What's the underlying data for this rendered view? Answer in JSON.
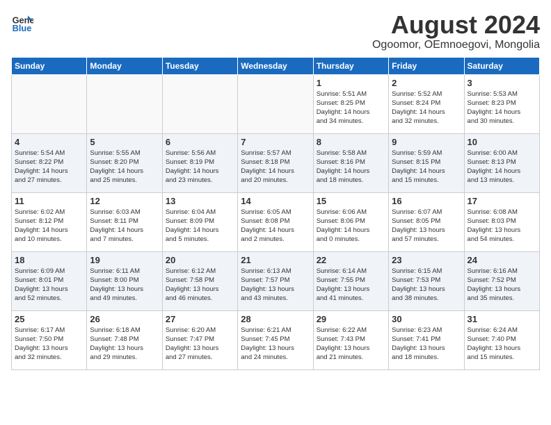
{
  "logo": {
    "general": "General",
    "blue": "Blue"
  },
  "title": "August 2024",
  "subtitle": "Ogoomor, OEmnoegovi, Mongolia",
  "days_of_week": [
    "Sunday",
    "Monday",
    "Tuesday",
    "Wednesday",
    "Thursday",
    "Friday",
    "Saturday"
  ],
  "weeks": [
    [
      {
        "day": "",
        "info": ""
      },
      {
        "day": "",
        "info": ""
      },
      {
        "day": "",
        "info": ""
      },
      {
        "day": "",
        "info": ""
      },
      {
        "day": "1",
        "info": "Sunrise: 5:51 AM\nSunset: 8:25 PM\nDaylight: 14 hours\nand 34 minutes."
      },
      {
        "day": "2",
        "info": "Sunrise: 5:52 AM\nSunset: 8:24 PM\nDaylight: 14 hours\nand 32 minutes."
      },
      {
        "day": "3",
        "info": "Sunrise: 5:53 AM\nSunset: 8:23 PM\nDaylight: 14 hours\nand 30 minutes."
      }
    ],
    [
      {
        "day": "4",
        "info": "Sunrise: 5:54 AM\nSunset: 8:22 PM\nDaylight: 14 hours\nand 27 minutes."
      },
      {
        "day": "5",
        "info": "Sunrise: 5:55 AM\nSunset: 8:20 PM\nDaylight: 14 hours\nand 25 minutes."
      },
      {
        "day": "6",
        "info": "Sunrise: 5:56 AM\nSunset: 8:19 PM\nDaylight: 14 hours\nand 23 minutes."
      },
      {
        "day": "7",
        "info": "Sunrise: 5:57 AM\nSunset: 8:18 PM\nDaylight: 14 hours\nand 20 minutes."
      },
      {
        "day": "8",
        "info": "Sunrise: 5:58 AM\nSunset: 8:16 PM\nDaylight: 14 hours\nand 18 minutes."
      },
      {
        "day": "9",
        "info": "Sunrise: 5:59 AM\nSunset: 8:15 PM\nDaylight: 14 hours\nand 15 minutes."
      },
      {
        "day": "10",
        "info": "Sunrise: 6:00 AM\nSunset: 8:13 PM\nDaylight: 14 hours\nand 13 minutes."
      }
    ],
    [
      {
        "day": "11",
        "info": "Sunrise: 6:02 AM\nSunset: 8:12 PM\nDaylight: 14 hours\nand 10 minutes."
      },
      {
        "day": "12",
        "info": "Sunrise: 6:03 AM\nSunset: 8:11 PM\nDaylight: 14 hours\nand 7 minutes."
      },
      {
        "day": "13",
        "info": "Sunrise: 6:04 AM\nSunset: 8:09 PM\nDaylight: 14 hours\nand 5 minutes."
      },
      {
        "day": "14",
        "info": "Sunrise: 6:05 AM\nSunset: 8:08 PM\nDaylight: 14 hours\nand 2 minutes."
      },
      {
        "day": "15",
        "info": "Sunrise: 6:06 AM\nSunset: 8:06 PM\nDaylight: 14 hours\nand 0 minutes."
      },
      {
        "day": "16",
        "info": "Sunrise: 6:07 AM\nSunset: 8:05 PM\nDaylight: 13 hours\nand 57 minutes."
      },
      {
        "day": "17",
        "info": "Sunrise: 6:08 AM\nSunset: 8:03 PM\nDaylight: 13 hours\nand 54 minutes."
      }
    ],
    [
      {
        "day": "18",
        "info": "Sunrise: 6:09 AM\nSunset: 8:01 PM\nDaylight: 13 hours\nand 52 minutes."
      },
      {
        "day": "19",
        "info": "Sunrise: 6:11 AM\nSunset: 8:00 PM\nDaylight: 13 hours\nand 49 minutes."
      },
      {
        "day": "20",
        "info": "Sunrise: 6:12 AM\nSunset: 7:58 PM\nDaylight: 13 hours\nand 46 minutes."
      },
      {
        "day": "21",
        "info": "Sunrise: 6:13 AM\nSunset: 7:57 PM\nDaylight: 13 hours\nand 43 minutes."
      },
      {
        "day": "22",
        "info": "Sunrise: 6:14 AM\nSunset: 7:55 PM\nDaylight: 13 hours\nand 41 minutes."
      },
      {
        "day": "23",
        "info": "Sunrise: 6:15 AM\nSunset: 7:53 PM\nDaylight: 13 hours\nand 38 minutes."
      },
      {
        "day": "24",
        "info": "Sunrise: 6:16 AM\nSunset: 7:52 PM\nDaylight: 13 hours\nand 35 minutes."
      }
    ],
    [
      {
        "day": "25",
        "info": "Sunrise: 6:17 AM\nSunset: 7:50 PM\nDaylight: 13 hours\nand 32 minutes."
      },
      {
        "day": "26",
        "info": "Sunrise: 6:18 AM\nSunset: 7:48 PM\nDaylight: 13 hours\nand 29 minutes."
      },
      {
        "day": "27",
        "info": "Sunrise: 6:20 AM\nSunset: 7:47 PM\nDaylight: 13 hours\nand 27 minutes."
      },
      {
        "day": "28",
        "info": "Sunrise: 6:21 AM\nSunset: 7:45 PM\nDaylight: 13 hours\nand 24 minutes."
      },
      {
        "day": "29",
        "info": "Sunrise: 6:22 AM\nSunset: 7:43 PM\nDaylight: 13 hours\nand 21 minutes."
      },
      {
        "day": "30",
        "info": "Sunrise: 6:23 AM\nSunset: 7:41 PM\nDaylight: 13 hours\nand 18 minutes."
      },
      {
        "day": "31",
        "info": "Sunrise: 6:24 AM\nSunset: 7:40 PM\nDaylight: 13 hours\nand 15 minutes."
      }
    ]
  ]
}
